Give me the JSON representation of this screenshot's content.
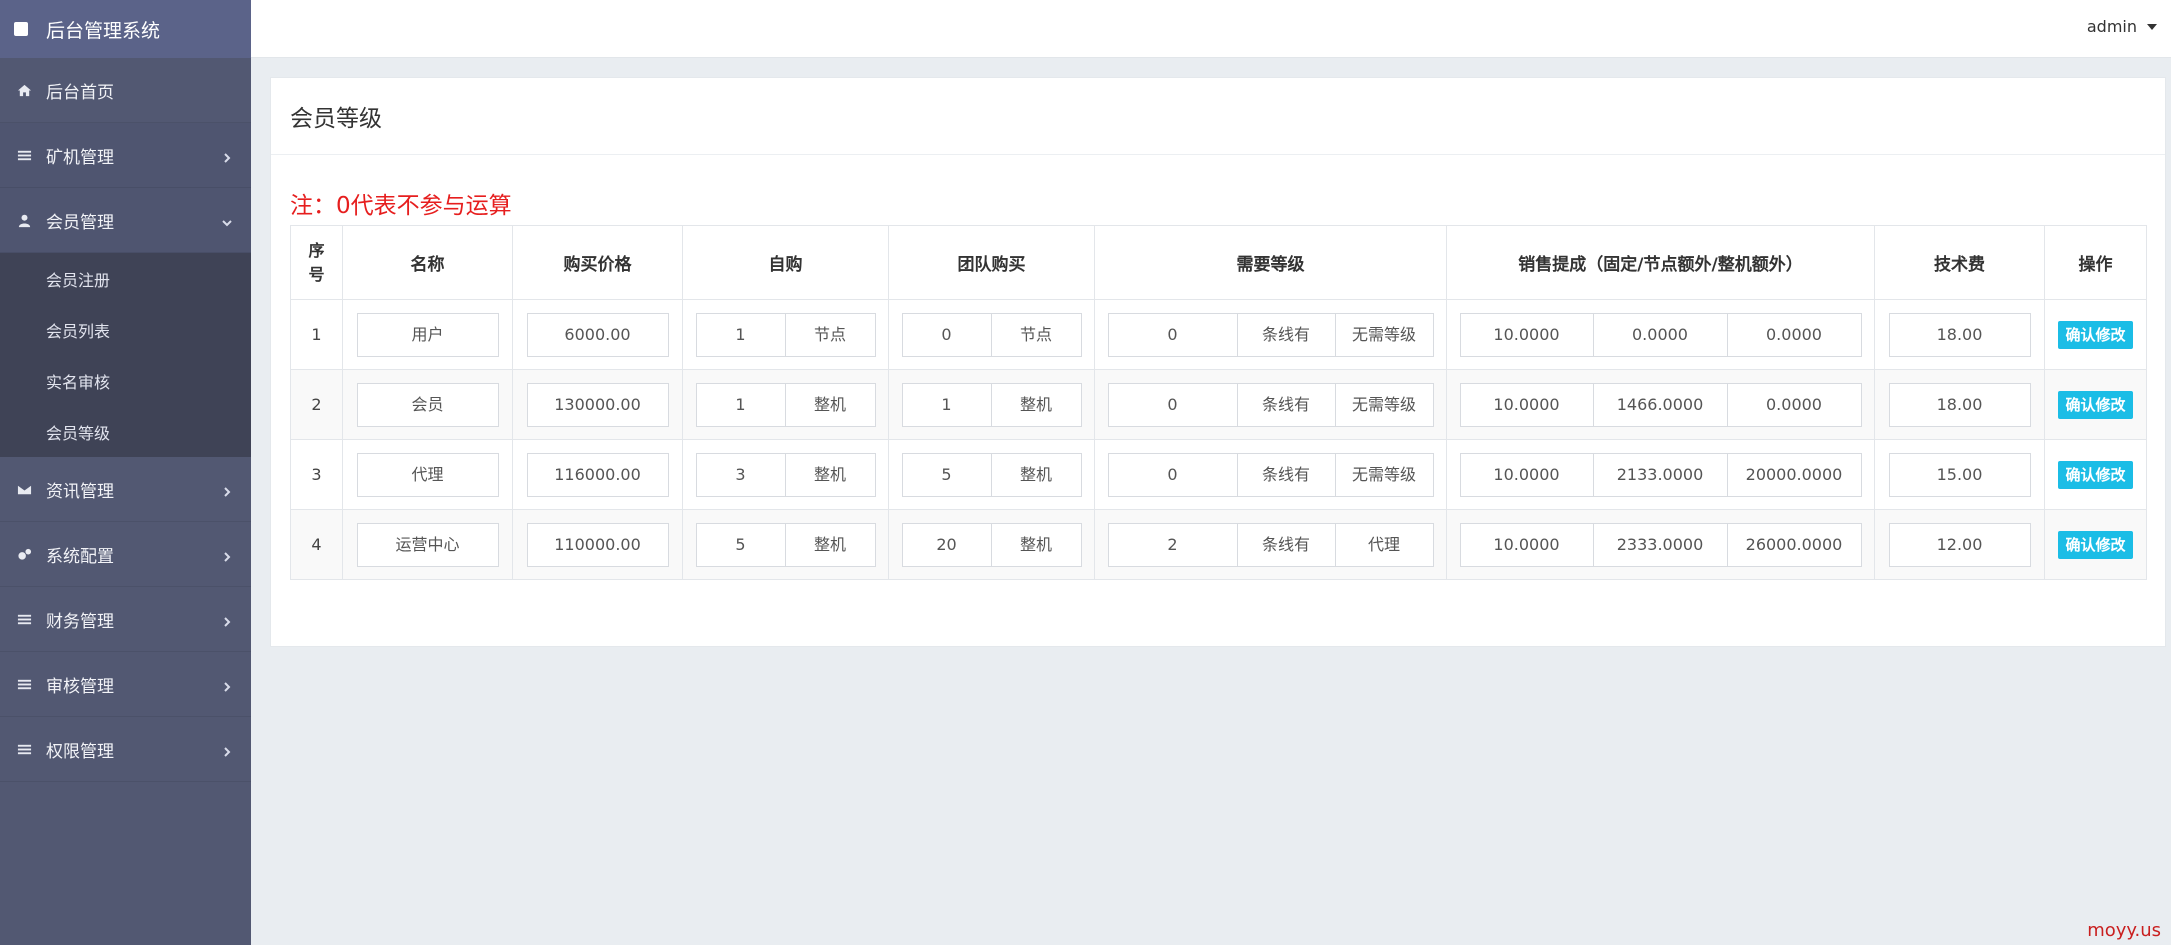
{
  "brand": "后台管理系统",
  "user": "admin",
  "sidebar": {
    "items": [
      {
        "label": "后台首页",
        "icon": "home-icon"
      },
      {
        "label": "矿机管理",
        "icon": "list-icon"
      },
      {
        "label": "会员管理",
        "icon": "user-icon"
      },
      {
        "label": "资讯管理",
        "icon": "envelope-icon"
      },
      {
        "label": "系统配置",
        "icon": "gears-icon"
      },
      {
        "label": "财务管理",
        "icon": "list-icon"
      },
      {
        "label": "审核管理",
        "icon": "list-icon"
      },
      {
        "label": "权限管理",
        "icon": "list-icon"
      }
    ],
    "submenu": [
      "会员注册",
      "会员列表",
      "实名审核",
      "会员等级"
    ]
  },
  "panel": {
    "title": "会员等级",
    "note": "注：0代表不参与运算"
  },
  "table": {
    "headers": [
      "序号",
      "名称",
      "购买价格",
      "自购",
      "团队购买",
      "需要等级",
      "销售提成（固定/节点额外/整机额外）",
      "技术费",
      "操作"
    ],
    "rows": [
      {
        "id": "1",
        "name": "用户",
        "price": "6000.00",
        "self_qty": "1",
        "self_unit": "节点",
        "team_qty": "0",
        "team_unit": "节点",
        "level_qty": "0",
        "level_unit": "条线有",
        "level_req": "无需等级",
        "s1": "10.0000",
        "s2": "0.0000",
        "s3": "0.0000",
        "fee": "18.00",
        "action": "确认修改"
      },
      {
        "id": "2",
        "name": "会员",
        "price": "130000.00",
        "self_qty": "1",
        "self_unit": "整机",
        "team_qty": "1",
        "team_unit": "整机",
        "level_qty": "0",
        "level_unit": "条线有",
        "level_req": "无需等级",
        "s1": "10.0000",
        "s2": "1466.0000",
        "s3": "0.0000",
        "fee": "18.00",
        "action": "确认修改"
      },
      {
        "id": "3",
        "name": "代理",
        "price": "116000.00",
        "self_qty": "3",
        "self_unit": "整机",
        "team_qty": "5",
        "team_unit": "整机",
        "level_qty": "0",
        "level_unit": "条线有",
        "level_req": "无需等级",
        "s1": "10.0000",
        "s2": "2133.0000",
        "s3": "20000.0000",
        "fee": "15.00",
        "action": "确认修改"
      },
      {
        "id": "4",
        "name": "运营中心",
        "price": "110000.00",
        "self_qty": "5",
        "self_unit": "整机",
        "team_qty": "20",
        "team_unit": "整机",
        "level_qty": "2",
        "level_unit": "条线有",
        "level_req": "代理",
        "s1": "10.0000",
        "s2": "2333.0000",
        "s3": "26000.0000",
        "fee": "12.00",
        "action": "确认修改"
      }
    ]
  },
  "watermark": "moyy.us"
}
